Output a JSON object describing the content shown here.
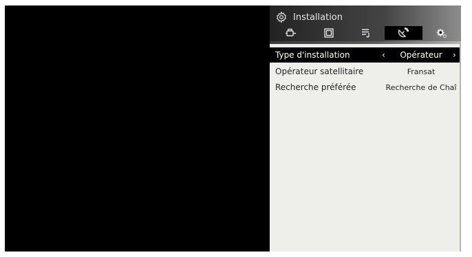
{
  "panel": {
    "title": "Installation",
    "title_icon": "gear-outline-icon",
    "tabs": [
      {
        "icon": "antenna-connector-icon",
        "active": false
      },
      {
        "icon": "picture-icon",
        "active": false
      },
      {
        "icon": "list-icon",
        "active": false
      },
      {
        "icon": "satellite-dish-icon",
        "active": true
      },
      {
        "icon": "gears-icon",
        "active": false
      }
    ]
  },
  "settings": [
    {
      "label": "Type d'installation",
      "value": "Opérateur",
      "selected": true,
      "prev_arrow": "‹",
      "next_arrow": "›"
    },
    {
      "label": "Opérateur satellitaire",
      "value": "Fransat",
      "selected": false
    },
    {
      "label": "Recherche préférée",
      "value": "Recherche de Chaî",
      "selected": false
    }
  ],
  "colors": {
    "screen_bg": "#000000",
    "content_bg": "#eeeeea",
    "selected_row_bg": "#000000",
    "header_text": "#e6e6e6"
  }
}
